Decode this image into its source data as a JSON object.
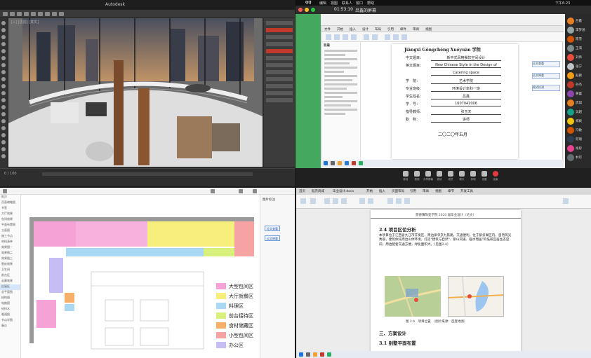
{
  "modeling_app": {
    "title": "Autodesk",
    "title_extra": "",
    "viewport_label": "[+] [透视] [真实]",
    "timeline_text": "0 / 100"
  },
  "mac_bar": {
    "apple": "",
    "app": "QQ",
    "menus": [
      "编辑",
      "视图",
      "联系人",
      "窗口",
      "帮助"
    ],
    "time": "下午6:23"
  },
  "meeting": {
    "timer": "01:53:10",
    "room": "吕鑫的屏幕",
    "controls": [
      "静音",
      "视频",
      "共享屏幕",
      "邀请",
      "成员",
      "聊天",
      "录制",
      "设置",
      "结束"
    ],
    "participants": [
      "吕鑫",
      "李梦涵",
      "陈雪",
      "王海",
      "刘伟",
      "张宁",
      "赵颖",
      "孙杰",
      "黄蕾",
      "周琪",
      "吴越",
      "郑爽",
      "冯敏",
      "何瑞",
      "徐彤",
      "林可"
    ]
  },
  "word": {
    "tabs": [
      "文件",
      "开始",
      "插入",
      "设计",
      "布局",
      "引用",
      "邮件",
      "审阅",
      "视图"
    ],
    "nav_title": "目录",
    "cover": {
      "title": "Jiāngxī Gōngchéng Xuéyuàn 学院",
      "rows": [
        {
          "k": "中文题目：",
          "v": "新中式风格餐饮空间设计"
        },
        {
          "k": "英文题目：",
          "v": "New Chinese Style in the Design of"
        },
        {
          "k": "",
          "v": "Catering space"
        },
        {
          "k": "学　院：",
          "v": "艺术学院"
        },
        {
          "k": "专业班级：",
          "v": "环境设计本科一班"
        },
        {
          "k": "学生姓名：",
          "v": "吕鑫"
        },
        {
          "k": "学　号：",
          "v": "1607041006"
        },
        {
          "k": "指导教师：",
          "v": "张玉天"
        },
        {
          "k": "职　称：",
          "v": "讲师"
        }
      ],
      "date": "二〇二〇年五月"
    },
    "side_buttons": [
      "论文查重",
      "论文降重",
      "格式检测"
    ]
  },
  "floor_plan": {
    "panel_title": "图片标注",
    "left_items": [
      "批注",
      "页面缩略图",
      "书签",
      "大厅效果",
      "包间效果",
      "平面布置图",
      "立面图",
      "施工节点",
      "材料清单",
      "效果图一",
      "效果图二",
      "效果图三",
      "厨房效果",
      "卫生间",
      "前台区",
      "走廊效果",
      "后厨区",
      "总平面图",
      "结构图",
      "电路图",
      "给排水",
      "暖通图",
      "节点详图",
      "备注"
    ],
    "right_buttons": [
      "论文查重",
      "论文降重"
    ],
    "legend": [
      {
        "label": "大型包间区",
        "color": "#f5a3d6"
      },
      {
        "label": "大厅就餐区",
        "color": "#f6ef7c"
      },
      {
        "label": "料理区",
        "color": "#a8d8f2"
      },
      {
        "label": "前台接待区",
        "color": "#d8f07c"
      },
      {
        "label": "食材储藏区",
        "color": "#f7b06b"
      },
      {
        "label": "小型包间区",
        "color": "#f5a3a3"
      },
      {
        "label": "办公区",
        "color": "#c6bdf5"
      }
    ]
  },
  "wps_doc": {
    "tabs": [
      "首页",
      "稻壳商城",
      "毕业设计.docx",
      "开始",
      "插入",
      "页面布局",
      "引用",
      "审阅",
      "视图",
      "章节",
      "开发工具"
    ],
    "header": "景德镇陶瓷学院 2020 届毕业设计（论文）",
    "h1": "2.4 项目区位分析",
    "para": "本项目位于江西省九江市开发区，周边紧邻京九铁路，交通便利，位于紫云阁区内，自然风光秀丽，建筑依托周边山体环境，打造\"建筑与自然\"、紫山同道、临水而居\"的低碳宜居生态空间，周边配套交通方便，绿化面积大。（见图2.4）",
    "caption": "图 2.4　项目位置　（图片来源：百度地图）",
    "h2": "三、方案设计",
    "h3": "3.1 别墅平面布置"
  }
}
